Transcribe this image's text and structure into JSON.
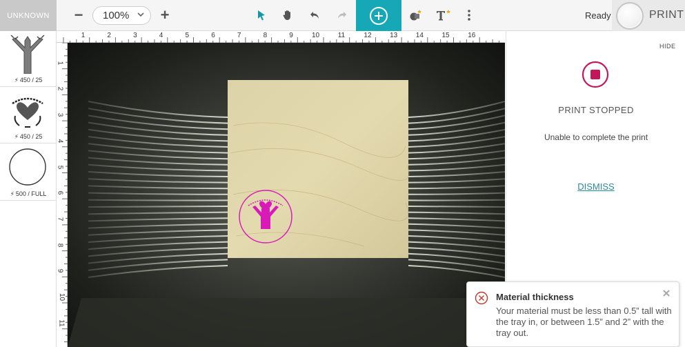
{
  "toolbar": {
    "material_label": "UNKNOWN",
    "zoom_minus": "−",
    "zoom_value": "100%",
    "zoom_plus": "+",
    "status": "Ready",
    "print_label": "PRINT"
  },
  "sidebar": {
    "items": [
      {
        "icon": "tree-design-icon",
        "settings": "450 / 25"
      },
      {
        "icon": "heart-logo-design-icon",
        "settings": "450 / 25"
      },
      {
        "icon": "circle-design-icon",
        "settings": "500 / FULL"
      }
    ]
  },
  "ruler": {
    "top": [
      "1",
      "2",
      "3",
      "4",
      "5",
      "6",
      "7",
      "8",
      "9",
      "10",
      "11",
      "12",
      "13",
      "14",
      "15",
      "16"
    ],
    "left": [
      "1",
      "2",
      "3",
      "4",
      "5",
      "6",
      "7",
      "8",
      "9",
      "10",
      "11"
    ]
  },
  "panel": {
    "hide": "HIDE",
    "title": "PRINT STOPPED",
    "message": "Unable to complete the print",
    "dismiss": "DISMISS"
  },
  "toast": {
    "title": "Material thickness",
    "body": "Your material must be less than 0.5” tall with the tray in, or between 1.5” and 2” with the tray out."
  },
  "colors": {
    "accent": "#17a8b8",
    "stop": "#c2185b",
    "engrave": "#d81ab8",
    "error": "#c0392b"
  }
}
